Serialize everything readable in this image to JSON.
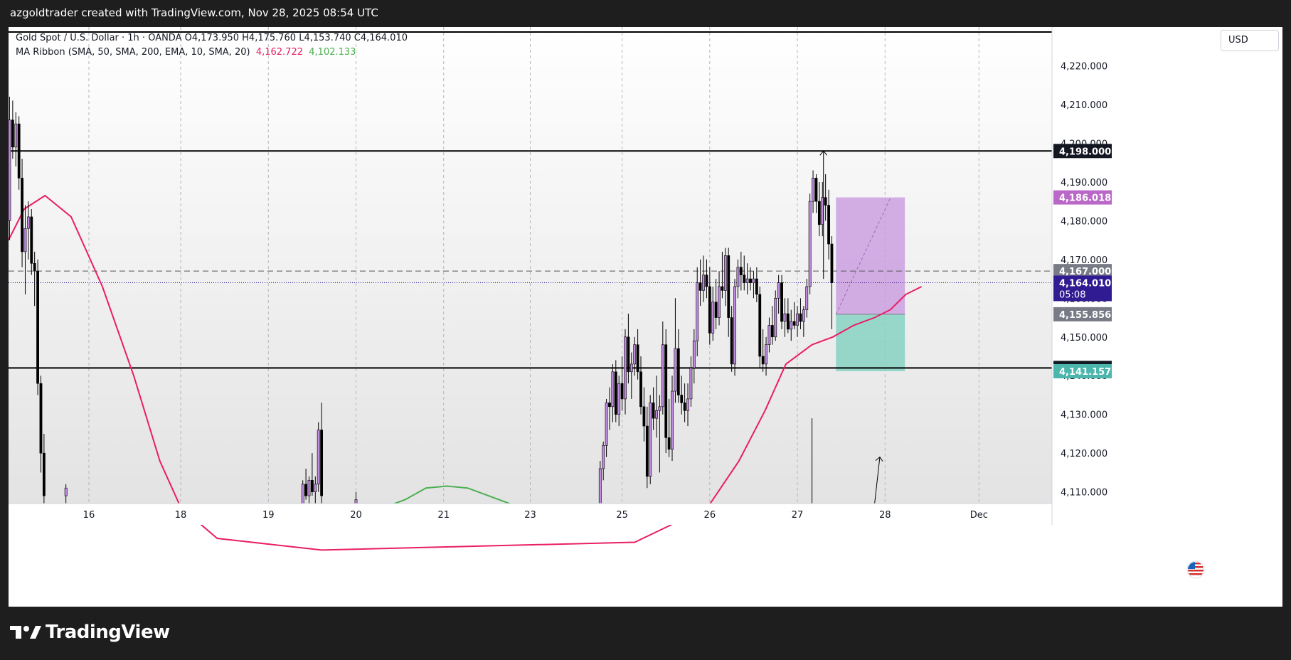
{
  "header": {
    "caption": "azgoldtrader created with TradingView.com, Nov 28, 2025 08:54 UTC"
  },
  "legend": {
    "symbol_line": "Gold Spot / U.S. Dollar · 1h · OANDA  O4,173.950  H4,175.760  L4,153.740  C4,164.010",
    "indicator_name": "MA Ribbon (SMA, 50, SMA, 200, EMA, 10, SMA, 20)",
    "indicator_value_1": "4,162.722",
    "indicator_value_2": "4,102.133"
  },
  "currency_label": "USD",
  "brand": {
    "name": "TradingView"
  },
  "colors": {
    "candle_up": "#ffffff",
    "candle_down": "#000000",
    "candle_up_alt": "#c08ae0",
    "ma_red": "#e91e63",
    "ma_green": "#4caf50",
    "target_zone": "#c99be0",
    "stop_zone": "#7fd1c0",
    "price_label_current": "#311b92",
    "price_label_purple": "#ba68c8",
    "price_label_green": "#4db6ac",
    "price_label_gray": "#787b86"
  },
  "icons": {
    "flag": "us-flag-icon",
    "logo": "tradingview-logo-icon"
  },
  "chart_data": {
    "type": "candlestick",
    "title": "Gold Spot / U.S. Dollar · 1h · OANDA",
    "ylim": [
      4107,
      4230
    ],
    "y_ticks": [
      4110,
      4120,
      4130,
      4140,
      4150,
      4160,
      4170,
      4180,
      4190,
      4200,
      4210,
      4220
    ],
    "y_tick_labels": [
      "4,110.000",
      "4,120.000",
      "4,130.000",
      "4,140.000",
      "4,150.000",
      "4,160.000",
      "4,170.000",
      "4,180.000",
      "4,190.000",
      "4,200.000",
      "4,210.000",
      "4,220.000"
    ],
    "x_tick_labels": [
      "16",
      "18",
      "19",
      "20",
      "21",
      "23",
      "25",
      "26",
      "27",
      "28",
      "Dec"
    ],
    "x_tick_positions": [
      0.077,
      0.165,
      0.249,
      0.333,
      0.417,
      0.5,
      0.588,
      0.672,
      0.756,
      0.84,
      0.93
    ],
    "horizontal_lines": [
      {
        "value": 4198.0,
        "label": "4,198.000",
        "style": "solid"
      },
      {
        "value": 4142.0,
        "label": "4,142.000",
        "style": "solid"
      },
      {
        "value": 4167.0,
        "label": "4,167.000",
        "style": "dashed"
      }
    ],
    "price_labels": [
      {
        "value": 4186.018,
        "label": "4,186.018",
        "kind": "target"
      },
      {
        "value": 4164.01,
        "label": "4,164.010",
        "sub": "05:08",
        "kind": "current"
      },
      {
        "value": 4155.856,
        "label": "4,155.856",
        "kind": "entry"
      },
      {
        "value": 4141.157,
        "label": "4,141.157",
        "kind": "stop"
      }
    ],
    "position_tool": {
      "x_start": 0.793,
      "x_end": 0.859,
      "target": 4186.018,
      "entry": 4155.856,
      "stop": 4141.157
    },
    "series": [
      {
        "name": "MA Ribbon SMA 50",
        "color": "#e91e63",
        "points": [
          [
            0.0,
            4175
          ],
          [
            0.015,
            4183
          ],
          [
            0.035,
            4186.5
          ],
          [
            0.06,
            4181
          ],
          [
            0.09,
            4163
          ],
          [
            0.12,
            4140
          ],
          [
            0.145,
            4118
          ],
          [
            0.165,
            4106
          ],
          [
            0.2,
            4098
          ],
          [
            0.3,
            4095
          ],
          [
            0.45,
            4096
          ],
          [
            0.6,
            4097
          ],
          [
            0.67,
            4106
          ],
          [
            0.7,
            4118
          ],
          [
            0.725,
            4131
          ],
          [
            0.745,
            4143
          ],
          [
            0.77,
            4148
          ],
          [
            0.79,
            4150
          ],
          [
            0.81,
            4153
          ],
          [
            0.83,
            4155
          ],
          [
            0.845,
            4157
          ],
          [
            0.86,
            4161
          ],
          [
            0.875,
            4163
          ]
        ]
      },
      {
        "name": "MA Ribbon SMA 200",
        "color": "#4caf50",
        "points": [
          [
            0.35,
            4105
          ],
          [
            0.38,
            4108
          ],
          [
            0.4,
            4111
          ],
          [
            0.42,
            4111.5
          ],
          [
            0.44,
            4111
          ],
          [
            0.47,
            4108
          ],
          [
            0.5,
            4105
          ]
        ]
      }
    ],
    "candles": [
      {
        "x": 0.001,
        "o": 4180,
        "h": 4212,
        "l": 4175,
        "c": 4206
      },
      {
        "x": 0.004,
        "o": 4206,
        "h": 4211,
        "l": 4196,
        "c": 4199
      },
      {
        "x": 0.007,
        "o": 4199,
        "h": 4208,
        "l": 4194,
        "c": 4205
      },
      {
        "x": 0.01,
        "o": 4205,
        "h": 4207,
        "l": 4188,
        "c": 4191
      },
      {
        "x": 0.013,
        "o": 4191,
        "h": 4196,
        "l": 4168,
        "c": 4172
      },
      {
        "x": 0.016,
        "o": 4172,
        "h": 4184,
        "l": 4161,
        "c": 4178
      },
      {
        "x": 0.019,
        "o": 4178,
        "h": 4185,
        "l": 4170,
        "c": 4181
      },
      {
        "x": 0.022,
        "o": 4181,
        "h": 4183,
        "l": 4166,
        "c": 4169
      },
      {
        "x": 0.025,
        "o": 4169,
        "h": 4172,
        "l": 4158,
        "c": 4167
      },
      {
        "x": 0.028,
        "o": 4167,
        "h": 4170,
        "l": 4135,
        "c": 4138
      },
      {
        "x": 0.031,
        "o": 4138,
        "h": 4140,
        "l": 4115,
        "c": 4120
      },
      {
        "x": 0.034,
        "o": 4120,
        "h": 4125,
        "l": 4107,
        "c": 4109
      },
      {
        "x": 0.055,
        "o": 4109,
        "h": 4112,
        "l": 4107,
        "c": 4111
      },
      {
        "x": 0.282,
        "o": 4107,
        "h": 4113,
        "l": 4107,
        "c": 4112
      },
      {
        "x": 0.285,
        "o": 4112,
        "h": 4116,
        "l": 4108,
        "c": 4109
      },
      {
        "x": 0.288,
        "o": 4109,
        "h": 4114,
        "l": 4107,
        "c": 4113
      },
      {
        "x": 0.291,
        "o": 4113,
        "h": 4120,
        "l": 4109,
        "c": 4110
      },
      {
        "x": 0.294,
        "o": 4110,
        "h": 4114,
        "l": 4107,
        "c": 4112
      },
      {
        "x": 0.297,
        "o": 4112,
        "h": 4128,
        "l": 4110,
        "c": 4126
      },
      {
        "x": 0.3,
        "o": 4126,
        "h": 4133,
        "l": 4107,
        "c": 4109
      },
      {
        "x": 0.333,
        "o": 4107,
        "h": 4110,
        "l": 4107,
        "c": 4108
      },
      {
        "x": 0.567,
        "o": 4107,
        "h": 4118,
        "l": 4107,
        "c": 4116
      },
      {
        "x": 0.57,
        "o": 4116,
        "h": 4123,
        "l": 4113,
        "c": 4122
      },
      {
        "x": 0.573,
        "o": 4122,
        "h": 4134,
        "l": 4119,
        "c": 4133
      },
      {
        "x": 0.576,
        "o": 4133,
        "h": 4137,
        "l": 4126,
        "c": 4132
      },
      {
        "x": 0.579,
        "o": 4132,
        "h": 4143,
        "l": 4128,
        "c": 4141
      },
      {
        "x": 0.582,
        "o": 4141,
        "h": 4144,
        "l": 4128,
        "c": 4130
      },
      {
        "x": 0.585,
        "o": 4130,
        "h": 4140,
        "l": 4127,
        "c": 4138
      },
      {
        "x": 0.588,
        "o": 4138,
        "h": 4145,
        "l": 4131,
        "c": 4134
      },
      {
        "x": 0.591,
        "o": 4134,
        "h": 4152,
        "l": 4130,
        "c": 4150
      },
      {
        "x": 0.594,
        "o": 4150,
        "h": 4156,
        "l": 4138,
        "c": 4141
      },
      {
        "x": 0.597,
        "o": 4141,
        "h": 4146,
        "l": 4134,
        "c": 4143
      },
      {
        "x": 0.6,
        "o": 4143,
        "h": 4150,
        "l": 4140,
        "c": 4148
      },
      {
        "x": 0.603,
        "o": 4148,
        "h": 4152,
        "l": 4139,
        "c": 4141
      },
      {
        "x": 0.606,
        "o": 4141,
        "h": 4145,
        "l": 4130,
        "c": 4132
      },
      {
        "x": 0.609,
        "o": 4132,
        "h": 4137,
        "l": 4123,
        "c": 4127
      },
      {
        "x": 0.612,
        "o": 4127,
        "h": 4132,
        "l": 4111,
        "c": 4114
      },
      {
        "x": 0.615,
        "o": 4114,
        "h": 4135,
        "l": 4112,
        "c": 4133
      },
      {
        "x": 0.618,
        "o": 4133,
        "h": 4137,
        "l": 4126,
        "c": 4129
      },
      {
        "x": 0.621,
        "o": 4129,
        "h": 4140,
        "l": 4124,
        "c": 4131
      },
      {
        "x": 0.624,
        "o": 4131,
        "h": 4135,
        "l": 4115,
        "c": 4132
      },
      {
        "x": 0.627,
        "o": 4132,
        "h": 4154,
        "l": 4130,
        "c": 4148
      },
      {
        "x": 0.63,
        "o": 4148,
        "h": 4152,
        "l": 4120,
        "c": 4124
      },
      {
        "x": 0.633,
        "o": 4124,
        "h": 4134,
        "l": 4119,
        "c": 4121
      },
      {
        "x": 0.636,
        "o": 4121,
        "h": 4140,
        "l": 4118,
        "c": 4136
      },
      {
        "x": 0.639,
        "o": 4136,
        "h": 4160,
        "l": 4133,
        "c": 4147
      },
      {
        "x": 0.642,
        "o": 4147,
        "h": 4152,
        "l": 4133,
        "c": 4135
      },
      {
        "x": 0.645,
        "o": 4135,
        "h": 4140,
        "l": 4130,
        "c": 4133
      },
      {
        "x": 0.648,
        "o": 4133,
        "h": 4138,
        "l": 4128,
        "c": 4131
      },
      {
        "x": 0.651,
        "o": 4131,
        "h": 4138,
        "l": 4127,
        "c": 4134
      },
      {
        "x": 0.654,
        "o": 4134,
        "h": 4145,
        "l": 4132,
        "c": 4142
      },
      {
        "x": 0.657,
        "o": 4142,
        "h": 4152,
        "l": 4138,
        "c": 4149
      },
      {
        "x": 0.66,
        "o": 4149,
        "h": 4168,
        "l": 4145,
        "c": 4164
      },
      {
        "x": 0.663,
        "o": 4164,
        "h": 4170,
        "l": 4158,
        "c": 4162
      },
      {
        "x": 0.666,
        "o": 4162,
        "h": 4171,
        "l": 4159,
        "c": 4166
      },
      {
        "x": 0.669,
        "o": 4166,
        "h": 4170,
        "l": 4160,
        "c": 4163
      },
      {
        "x": 0.672,
        "o": 4163,
        "h": 4168,
        "l": 4148,
        "c": 4151
      },
      {
        "x": 0.675,
        "o": 4151,
        "h": 4163,
        "l": 4149,
        "c": 4159
      },
      {
        "x": 0.678,
        "o": 4159,
        "h": 4165,
        "l": 4152,
        "c": 4155
      },
      {
        "x": 0.681,
        "o": 4155,
        "h": 4167,
        "l": 4153,
        "c": 4163
      },
      {
        "x": 0.684,
        "o": 4163,
        "h": 4172,
        "l": 4160,
        "c": 4162
      },
      {
        "x": 0.687,
        "o": 4162,
        "h": 4173,
        "l": 4158,
        "c": 4171
      },
      {
        "x": 0.69,
        "o": 4171,
        "h": 4173,
        "l": 4150,
        "c": 4155
      },
      {
        "x": 0.693,
        "o": 4155,
        "h": 4158,
        "l": 4141,
        "c": 4143
      },
      {
        "x": 0.696,
        "o": 4143,
        "h": 4165,
        "l": 4140,
        "c": 4163
      },
      {
        "x": 0.699,
        "o": 4163,
        "h": 4170,
        "l": 4160,
        "c": 4168
      },
      {
        "x": 0.702,
        "o": 4168,
        "h": 4172,
        "l": 4162,
        "c": 4166
      },
      {
        "x": 0.705,
        "o": 4166,
        "h": 4171,
        "l": 4162,
        "c": 4164
      },
      {
        "x": 0.708,
        "o": 4164,
        "h": 4169,
        "l": 4161,
        "c": 4165
      },
      {
        "x": 0.711,
        "o": 4165,
        "h": 4168,
        "l": 4162,
        "c": 4164
      },
      {
        "x": 0.714,
        "o": 4164,
        "h": 4167,
        "l": 4160,
        "c": 4165
      },
      {
        "x": 0.717,
        "o": 4165,
        "h": 4168,
        "l": 4159,
        "c": 4161
      },
      {
        "x": 0.72,
        "o": 4161,
        "h": 4163,
        "l": 4142,
        "c": 4145
      },
      {
        "x": 0.723,
        "o": 4145,
        "h": 4152,
        "l": 4141,
        "c": 4143
      },
      {
        "x": 0.726,
        "o": 4143,
        "h": 4150,
        "l": 4140,
        "c": 4148
      },
      {
        "x": 0.729,
        "o": 4148,
        "h": 4155,
        "l": 4146,
        "c": 4153
      },
      {
        "x": 0.732,
        "o": 4153,
        "h": 4158,
        "l": 4148,
        "c": 4150
      },
      {
        "x": 0.735,
        "o": 4150,
        "h": 4162,
        "l": 4149,
        "c": 4160
      },
      {
        "x": 0.738,
        "o": 4160,
        "h": 4166,
        "l": 4156,
        "c": 4164
      },
      {
        "x": 0.741,
        "o": 4164,
        "h": 4166,
        "l": 4152,
        "c": 4154
      },
      {
        "x": 0.744,
        "o": 4154,
        "h": 4160,
        "l": 4150,
        "c": 4156
      },
      {
        "x": 0.747,
        "o": 4156,
        "h": 4160,
        "l": 4151,
        "c": 4152
      },
      {
        "x": 0.75,
        "o": 4152,
        "h": 4157,
        "l": 4149,
        "c": 4154
      },
      {
        "x": 0.753,
        "o": 4154,
        "h": 4159,
        "l": 4152,
        "c": 4153
      },
      {
        "x": 0.756,
        "o": 4153,
        "h": 4158,
        "l": 4150,
        "c": 4156
      },
      {
        "x": 0.759,
        "o": 4156,
        "h": 4160,
        "l": 4152,
        "c": 4154
      },
      {
        "x": 0.762,
        "o": 4154,
        "h": 4158,
        "l": 4150,
        "c": 4157
      },
      {
        "x": 0.765,
        "o": 4157,
        "h": 4165,
        "l": 4155,
        "c": 4163
      },
      {
        "x": 0.768,
        "o": 4163,
        "h": 4187,
        "l": 4161,
        "c": 4185
      },
      {
        "x": 0.771,
        "o": 4185,
        "h": 4193,
        "l": 4182,
        "c": 4191
      },
      {
        "x": 0.774,
        "o": 4191,
        "h": 4192,
        "l": 4182,
        "c": 4185
      },
      {
        "x": 0.777,
        "o": 4185,
        "h": 4190,
        "l": 4176,
        "c": 4179
      },
      {
        "x": 0.78,
        "o": 4179,
        "h": 4190,
        "l": 4176,
        "c": 4186
      },
      {
        "x": 0.783,
        "o": 4186,
        "h": 4192,
        "l": 4180,
        "c": 4184
      },
      {
        "x": 0.786,
        "o": 4184,
        "h": 4188,
        "l": 4170,
        "c": 4174
      },
      {
        "x": 0.789,
        "o": 4174,
        "h": 4176,
        "l": 4152,
        "c": 4164
      }
    ]
  }
}
